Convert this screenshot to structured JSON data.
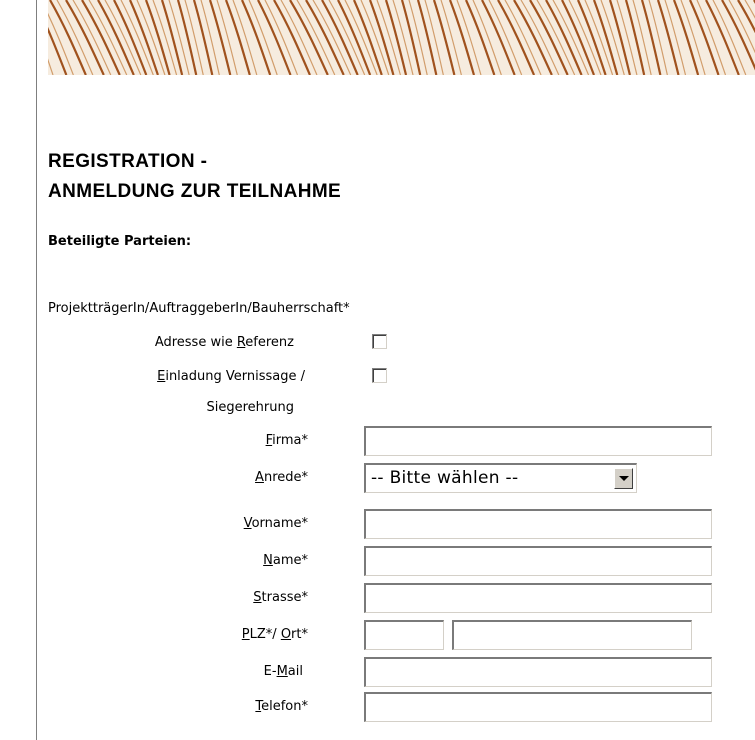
{
  "form": {
    "title_line1": "REGISTRATION -",
    "title_line2": "ANMELDUNG ZUR TEILNAHME",
    "section_heading": "Beteiligte Parteien:",
    "party_label": "ProjektträgerIn/AuftraggeberIn/Bauherrschaft*",
    "checkboxes": {
      "same_address": {
        "label_pre": "Adresse wie ",
        "label_key": "R",
        "label_post": "eferenz",
        "checked": false
      },
      "invitation": {
        "label_pre": "",
        "label_key": "E",
        "label_post": "inladung Vernissage /",
        "label_line2": "Siegerehrung",
        "checked": false
      }
    },
    "fields": {
      "firma": {
        "label_key": "F",
        "label_post": "irma*",
        "value": ""
      },
      "anrede": {
        "label_key": "A",
        "label_post": "nrede*",
        "selected": "-- Bitte wählen --"
      },
      "vorname": {
        "label_key": "V",
        "label_post": "orname*",
        "value": ""
      },
      "name": {
        "label_key": "N",
        "label_post": "ame*",
        "value": ""
      },
      "strasse": {
        "label_key": "S",
        "label_post": "trasse*",
        "value": ""
      },
      "plz_ort": {
        "label_key1": "P",
        "label_mid": "LZ*/ ",
        "label_key2": "O",
        "label_post": "rt*",
        "plz_value": "",
        "ort_value": ""
      },
      "email": {
        "label_pre": "E-",
        "label_key": "M",
        "label_post": "ail",
        "value": ""
      },
      "telefon": {
        "label_key": "T",
        "label_post": "elefon*",
        "value": ""
      }
    }
  },
  "colors": {
    "banner_stripe": "#a0521e",
    "banner_bg": "#f5e9d8"
  }
}
